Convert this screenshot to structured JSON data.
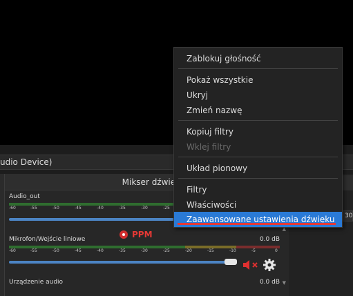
{
  "source_bar": {
    "text": "udio Device)"
  },
  "mixer": {
    "title": "Mikser dźwięku",
    "annotation": "PPM",
    "channels": [
      {
        "name": "Audio_out",
        "db": ""
      },
      {
        "name": "Mikrofon/Wejście liniowe",
        "db": "0.0 dB"
      },
      {
        "name": "Urządzenie audio",
        "db": "0.0 dB"
      }
    ],
    "ticks": [
      "-60",
      "-55",
      "-50",
      "-45",
      "-40",
      "-35",
      "-30",
      "-25",
      "-20",
      "-15",
      "-10",
      "-5",
      "0"
    ]
  },
  "right_panel": {
    "input_value": "30"
  },
  "context_menu": {
    "items": [
      {
        "label": "Zablokuj głośność",
        "enabled": true
      },
      {
        "label": "Pokaż wszystkie",
        "enabled": true
      },
      {
        "label": "Ukryj",
        "enabled": true
      },
      {
        "label": "Zmień nazwę",
        "enabled": true
      },
      {
        "label": "Kopiuj filtry",
        "enabled": true
      },
      {
        "label": "Wklej filtry",
        "enabled": false
      },
      {
        "label": "Układ pionowy",
        "enabled": true
      },
      {
        "label": "Filtry",
        "enabled": true
      },
      {
        "label": "Właściwości",
        "enabled": true
      },
      {
        "label": "Zaawansowane ustawienia dźwięku",
        "enabled": true,
        "selected": true
      }
    ]
  },
  "colors": {
    "accent": "#2a7ad6",
    "slider": "#4c84c4",
    "annotation_red": "#e53935",
    "meter_green": "#2f6d2f",
    "meter_yellow": "#7a6c28",
    "meter_red": "#7a2d2d"
  },
  "icons": {
    "mute": "speaker-muted-icon",
    "settings": "gear-icon",
    "annotation_marker": "record-dot-icon"
  }
}
